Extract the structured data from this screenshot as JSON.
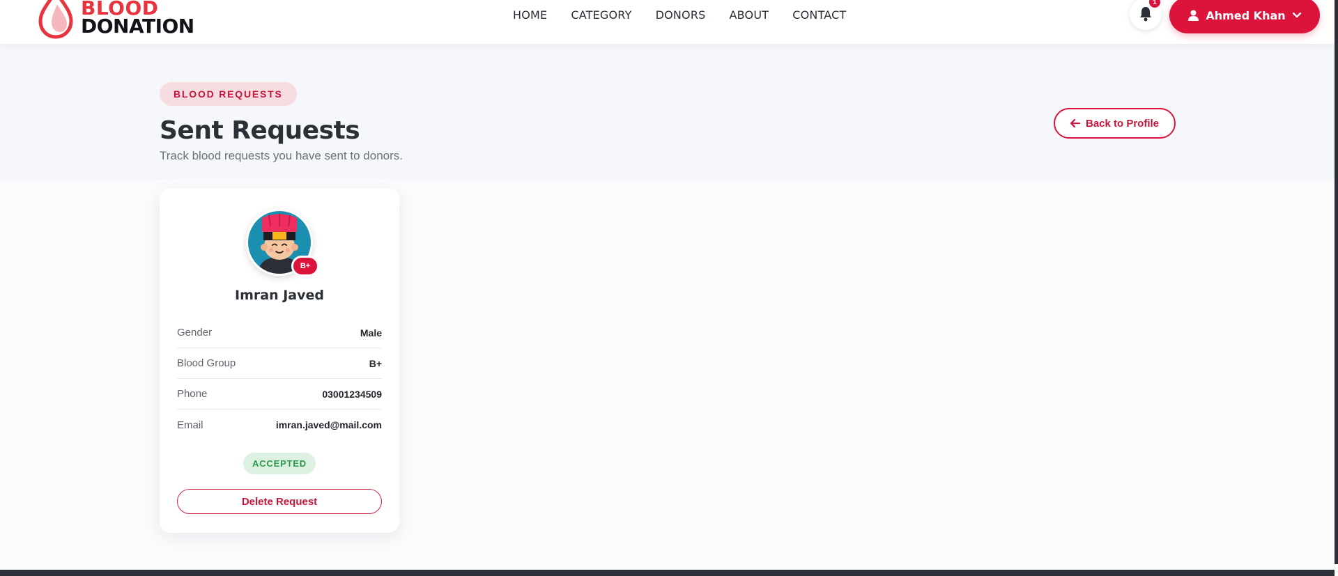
{
  "brand": {
    "line1": "BLOOD",
    "line2": "DONATION",
    "accent": "#dc143c"
  },
  "nav": {
    "items": [
      {
        "label": "HOME"
      },
      {
        "label": "CATEGORY"
      },
      {
        "label": "DONORS"
      },
      {
        "label": "ABOUT"
      },
      {
        "label": "CONTACT"
      }
    ]
  },
  "header": {
    "notifications_count": "1",
    "user_name": "Ahmed Khan",
    "icons": {
      "bell": "bell-icon",
      "user": "user-icon",
      "chevron": "chevron-down-icon"
    }
  },
  "page": {
    "section_label": "BLOOD REQUESTS",
    "title": "Sent Requests",
    "subtitle": "Track blood requests you have sent to donors.",
    "back_label": "Back to Profile"
  },
  "requests": [
    {
      "name": "Imran Javed",
      "badge": "B+",
      "fields": [
        {
          "label": "Gender",
          "value": "Male"
        },
        {
          "label": "Blood Group",
          "value": "B+"
        },
        {
          "label": "Phone",
          "value": "03001234509"
        },
        {
          "label": "Email",
          "value": "imran.javed@mail.com"
        }
      ],
      "status": "ACCEPTED",
      "delete_label": "Delete Request"
    }
  ]
}
